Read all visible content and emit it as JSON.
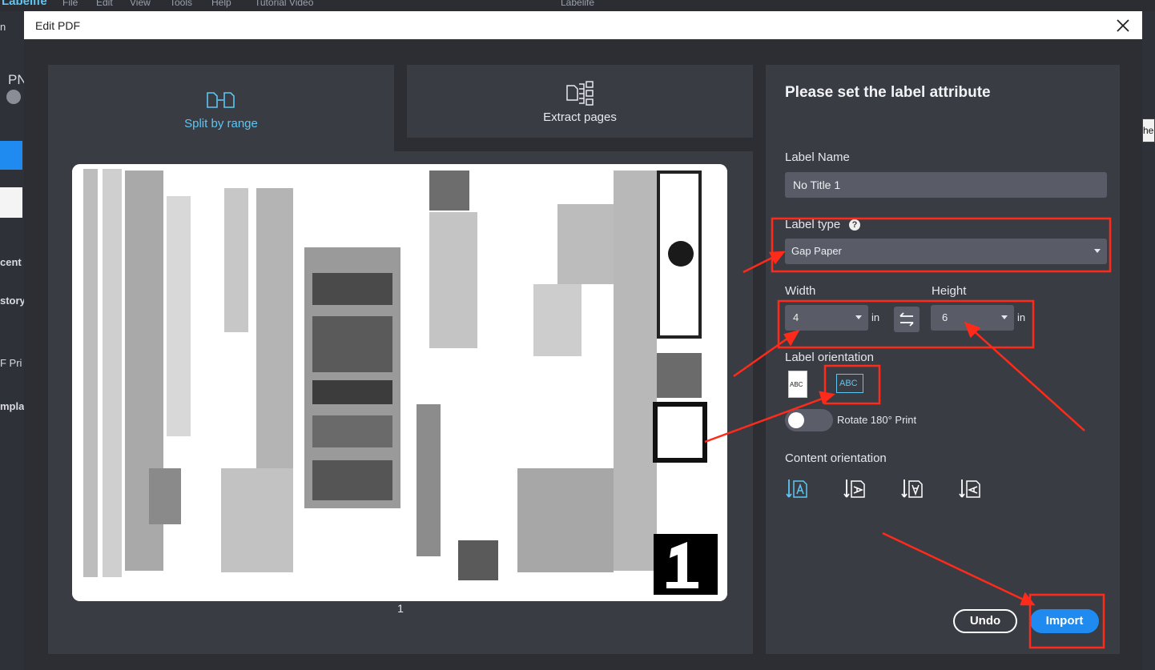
{
  "background_app": {
    "title": "Labelife",
    "menu": [
      "File",
      "Edit",
      "View",
      "Tools",
      "Help",
      "Tutorial Video"
    ],
    "left_fragments": [
      "n",
      "PN",
      "cent",
      "story",
      "F Pri",
      "mpla"
    ],
    "right_fragment": "he"
  },
  "dialog": {
    "title": "Edit PDF"
  },
  "tabs": [
    {
      "label": "Split by range",
      "active": true,
      "icon": "split-pages-icon"
    },
    {
      "label": "Extract pages",
      "active": false,
      "icon": "extract-pages-icon"
    }
  ],
  "preview": {
    "page_number": "1"
  },
  "settings": {
    "title": "Please set the label attribute",
    "label_name_label": "Label Name",
    "label_name_value": "No Title 1",
    "label_type_label": "Label type",
    "label_type_value": "Gap Paper",
    "width_label": "Width",
    "width_value": "4",
    "height_label": "Height",
    "height_value": "6",
    "unit": "in",
    "orientation_label": "Label orientation",
    "orientation_options": [
      "ABC",
      "ABC"
    ],
    "orientation_selected": 1,
    "rotate_label": "Rotate 180° Print",
    "rotate_on": false,
    "content_orientation_label": "Content orientation",
    "content_orientation_selected": 0,
    "content_orientation_options": [
      "content-down-0-icon",
      "content-down-90-icon",
      "content-down-180-icon",
      "content-down-270-icon"
    ]
  },
  "buttons": {
    "undo": "Undo",
    "import": "Import"
  },
  "colors": {
    "accent": "#1f8bf1",
    "annotation": "#ff2a1a",
    "active_tab_text": "#5ec6f2"
  }
}
